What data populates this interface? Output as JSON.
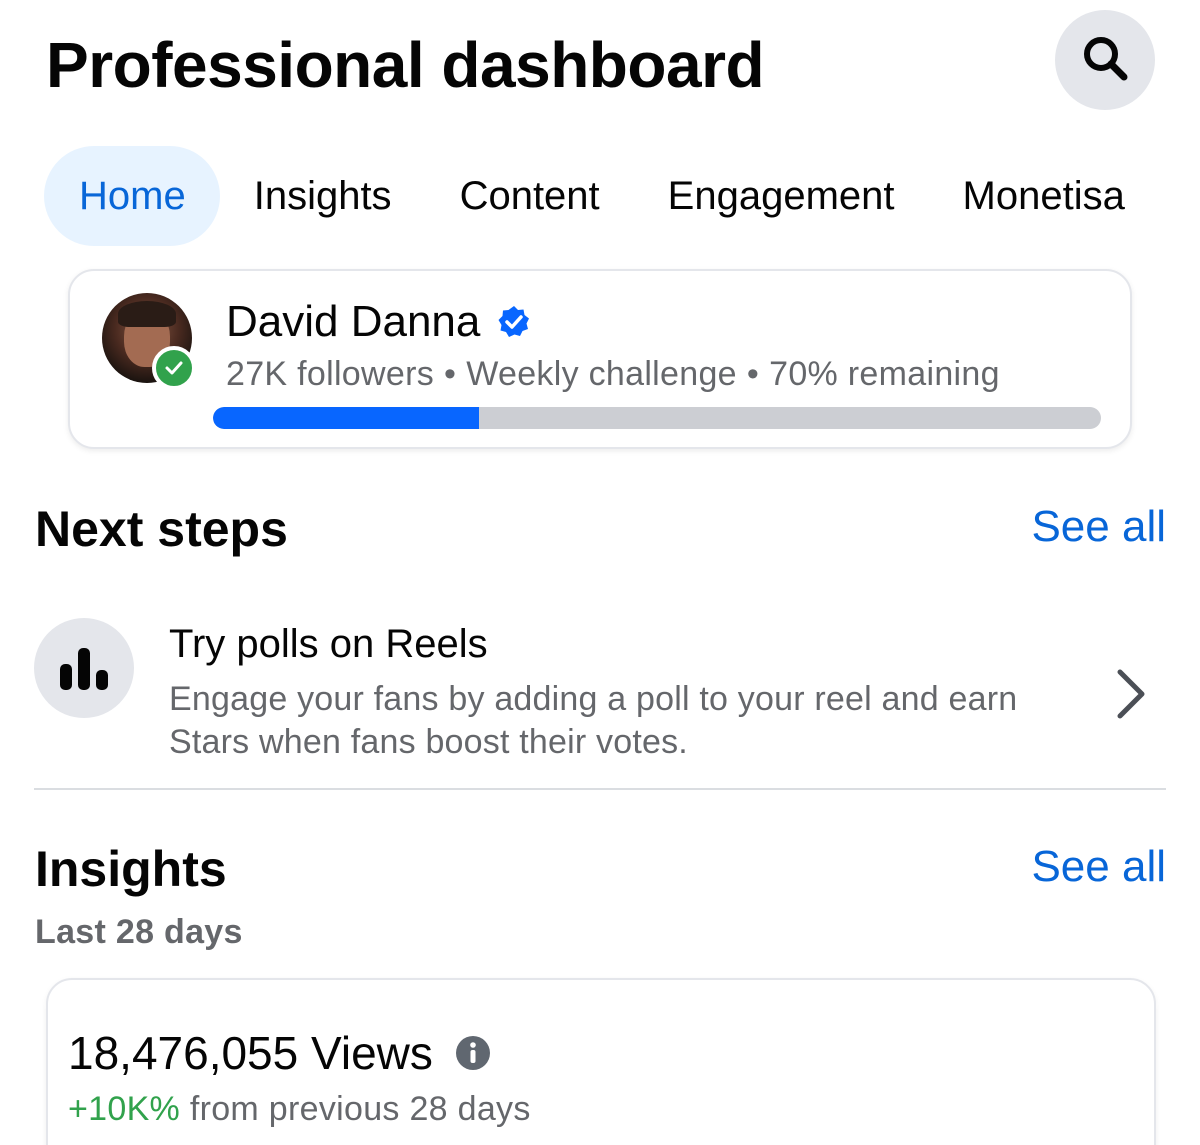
{
  "header": {
    "title": "Professional dashboard",
    "search_icon": "search-icon"
  },
  "tabs": [
    {
      "label": "Home",
      "active": true
    },
    {
      "label": "Insights",
      "active": false
    },
    {
      "label": "Content",
      "active": false
    },
    {
      "label": "Engagement",
      "active": false
    },
    {
      "label": "Monetisa",
      "active": false
    }
  ],
  "profile": {
    "name": "David Danna",
    "verified_icon": "verified-badge-icon",
    "followers": "27K followers",
    "separator": "•",
    "challenge": "Weekly challenge",
    "remaining": "70% remaining",
    "progress_fraction": 0.3,
    "colors": {
      "progress": "#0866ff",
      "track": "#ccced3",
      "online": "#31a24c"
    }
  },
  "next_steps": {
    "title": "Next steps",
    "see_all": "See all",
    "items": [
      {
        "icon": "bar-chart-icon",
        "title": "Try polls on Reels",
        "description": "Engage your fans by adding a poll to your reel and earn Stars when fans boost their votes."
      }
    ]
  },
  "insights": {
    "title": "Insights",
    "see_all": "See all",
    "period": "Last 28 days",
    "views_value": "18,476,055 Views",
    "change_pct": "+10K%",
    "change_text": "from previous 28 days",
    "colors": {
      "positive": "#31a24c",
      "link": "#0866d8"
    }
  }
}
